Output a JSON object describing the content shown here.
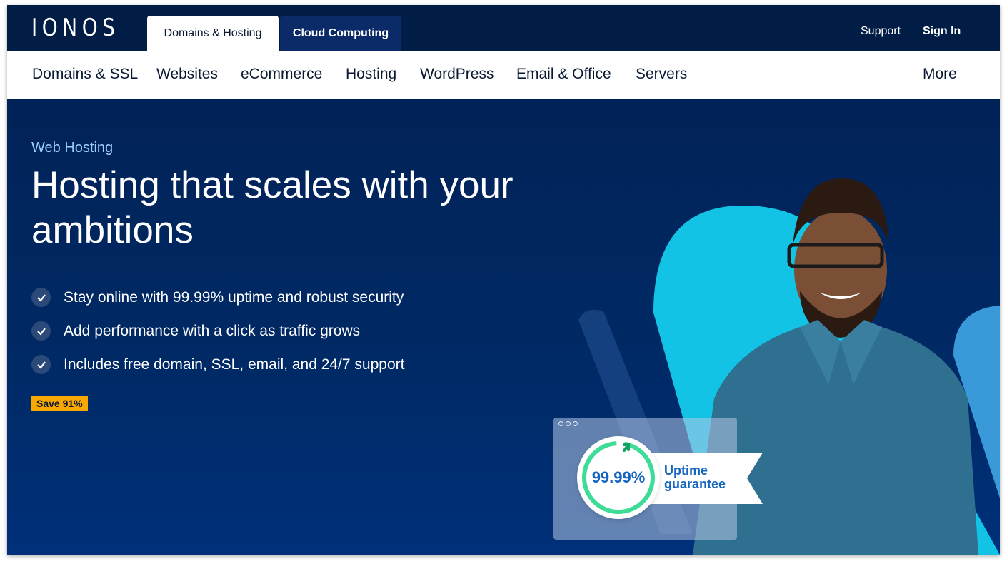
{
  "brand": {
    "logo": "IONOS"
  },
  "top_tabs": [
    {
      "label": "Domains & Hosting",
      "active": true
    },
    {
      "label": "Cloud Computing",
      "active": false
    }
  ],
  "top_links": {
    "support": "Support",
    "sign_in": "Sign In"
  },
  "nav": {
    "items": [
      "Domains & SSL",
      "Websites",
      "eCommerce",
      "Hosting",
      "WordPress",
      "Email & Office",
      "Servers"
    ],
    "more": "More"
  },
  "hero": {
    "eyebrow": "Web Hosting",
    "headline_line1": "Hosting that scales with your",
    "headline_line2": "ambitions",
    "features": [
      {
        "icon": "check-icon",
        "text": "Stay online with 99.99% uptime and robust security"
      },
      {
        "icon": "check-icon",
        "text": "Add performance with a click as traffic grows"
      },
      {
        "icon": "check-icon",
        "text": "Includes free domain, SSL, email, and 24/7 support"
      }
    ],
    "badge": "Save 91%",
    "uptime_card": {
      "value": "99.99%",
      "label_line1": "Uptime",
      "label_line2": "guarantee"
    }
  },
  "colors": {
    "topbar": "#011d45",
    "hero_bg": "#002a66",
    "accent_cyan": "#12c3e6",
    "badge": "#f8a800",
    "uptime_green": "#3ddc97",
    "uptime_blue": "#1565c0"
  }
}
